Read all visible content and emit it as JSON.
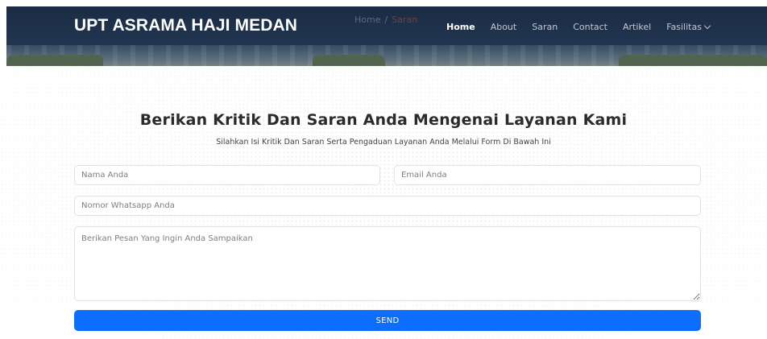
{
  "header": {
    "brand": "UPT ASRAMA HAJI MEDAN",
    "breadcrumb": {
      "home": "Home",
      "separator": "/",
      "current": "Saran"
    },
    "nav": [
      {
        "label": "Home",
        "active": true
      },
      {
        "label": "About",
        "active": false
      },
      {
        "label": "Saran",
        "active": false
      },
      {
        "label": "Contact",
        "active": false
      },
      {
        "label": "Artikel",
        "active": false
      },
      {
        "label": "Fasilitas",
        "active": false,
        "dropdown": true
      }
    ]
  },
  "form": {
    "title": "Berikan Kritik Dan Saran Anda Mengenai Layanan Kami",
    "subtitle": "Silahkan Isi Kritik Dan Saran Serta Pengaduan Layanan Anda Melalui Form Di Bawah Ini",
    "name_placeholder": "Nama Anda",
    "email_placeholder": "Email Anda",
    "whatsapp_placeholder": "Nomor Whatsapp Anda",
    "message_placeholder": "Berikan Pesan Yang Ingin Anda Sampaikan",
    "send_label": "SEND"
  },
  "colors": {
    "header_bg": "#1d2f48",
    "send_button": "#0d6efd"
  },
  "icons": {
    "fasilitas_dropdown": "chevron-down-icon"
  }
}
